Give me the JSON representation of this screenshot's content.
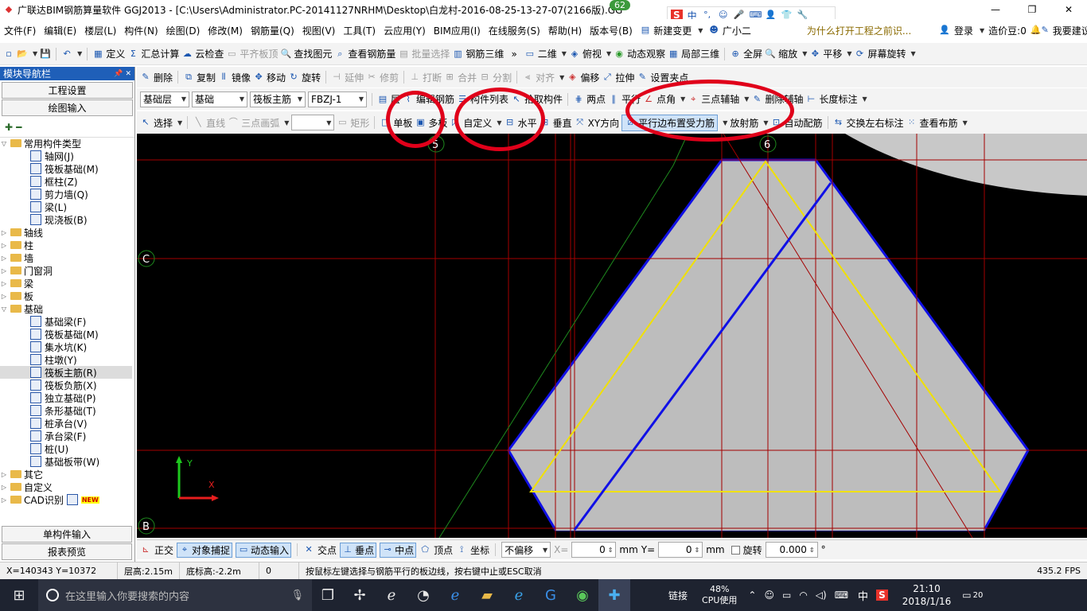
{
  "titlebar": {
    "title": "广联达BIM钢筋算量软件 GGJ2013 - [C:\\Users\\Administrator.PC-20141127NRHM\\Desktop\\白龙村-2016-08-25-13-27-07(2166版).GG",
    "badge": "62",
    "min": "—",
    "max": "❐",
    "close": "✕"
  },
  "ime": {
    "logo": "S",
    "lang": "中"
  },
  "menu": {
    "items": [
      "文件(F)",
      "编辑(E)",
      "楼层(L)",
      "构件(N)",
      "绘图(D)",
      "修改(M)",
      "钢筋量(Q)",
      "视图(V)",
      "工具(T)",
      "云应用(Y)",
      "BIM应用(I)",
      "在线服务(S)",
      "帮助(H)",
      "版本号(B)"
    ],
    "new_change": "新建变更",
    "guangxiao": "广小二",
    "notice": "为什么打开工程之前识...",
    "login": "登录",
    "price_bean": "造价豆:0",
    "suggest": "我要建议"
  },
  "tb1": {
    "items": [
      "定义",
      "汇总计算",
      "云检查",
      "平齐板顶",
      "查找图元",
      "查看钢筋量",
      "批量选择",
      "钢筋三维"
    ],
    "view2d": "二维",
    "top_view": "俯视",
    "dyn_observe": "动态观察",
    "local3d": "局部三维",
    "fullscreen": "全屏",
    "zoom": "缩放",
    "pan": "平移",
    "rotate_screen": "屏幕旋转"
  },
  "tb2": {
    "items": [
      "删除",
      "复制",
      "镜像",
      "移动",
      "旋转",
      "延伸",
      "修剪",
      "打断",
      "合并",
      "分割",
      "对齐",
      "偏移",
      "拉伸",
      "设置夹点"
    ]
  },
  "tb3": {
    "floor": "基础层",
    "category": "基础",
    "type": "筏板主筋",
    "name": "FBZJ-1",
    "layer": "层",
    "edit_rebar": "编辑钢筋",
    "comp_list": "构件列表",
    "pick": "拾取构件",
    "two_pts": "两点",
    "parallel": "平行",
    "pt_angle": "点角",
    "three_pt_aux": "三点辅轴",
    "del_aux": "删除辅轴",
    "dim": "长度标注"
  },
  "tb4": {
    "select": "选择",
    "line": "直线",
    "arc": "三点画弧",
    "rect": "矩形",
    "single": "单板",
    "multi": "多板",
    "custom": "自定义",
    "horizontal": "水平",
    "vertical": "垂直",
    "xy": "XY方向",
    "parallel_edge": "平行边布置受力筋",
    "rebar_dir": "放射筋",
    "auto_rebar": "自动配筋",
    "swap_lr": "交换左右标注",
    "view_rebar": "查看布筋"
  },
  "nav": {
    "title": "模块导航栏",
    "pin": "📌 ✕",
    "project_settings": "工程设置",
    "drawing_input": "绘图输入",
    "single_input": "单构件输入",
    "report": "报表预览"
  },
  "tree": {
    "common": "常用构件类型",
    "common_items": [
      "轴网(J)",
      "筏板基础(M)",
      "框柱(Z)",
      "剪力墙(Q)",
      "梁(L)",
      "现浇板(B)"
    ],
    "axis": "轴线",
    "column": "柱",
    "wall": "墙",
    "door": "门窗洞",
    "beam": "梁",
    "slab": "板",
    "foundation": "基础",
    "foundation_items": [
      "基础梁(F)",
      "筏板基础(M)",
      "集水坑(K)",
      "柱墩(Y)",
      "筏板主筋(R)",
      "筏板负筋(X)",
      "独立基础(P)",
      "条形基础(T)",
      "桩承台(V)",
      "承台梁(F)",
      "桩(U)",
      "基础板带(W)"
    ],
    "other": "其它",
    "custom": "自定义",
    "cad": "CAD识别",
    "new_badge": "NEW"
  },
  "canvas": {
    "axis_labels": [
      "5",
      "6",
      "C",
      "B"
    ],
    "y_axis": "Y",
    "x_axis": "X"
  },
  "bottombar": {
    "ortho": "正交",
    "snap": "对象捕捉",
    "dyn_input": "动态输入",
    "intersect": "交点",
    "perp": "垂点",
    "mid": "中点",
    "vertex": "顶点",
    "coord": "坐标",
    "offset": "不偏移",
    "x_label": "X=",
    "x_val": "0",
    "y_label": "Y=",
    "y_val": "0",
    "unit": "mm",
    "rotate": "旋转",
    "angle": "0.000",
    "deg": "°"
  },
  "status": {
    "coords": "X=140343 Y=10372",
    "floor_h": "层高:2.15m",
    "bottom_h": "底标高:-2.2m",
    "zero": "0",
    "hint": "按鼠标左键选择与钢筋平行的板边线，按右键中止或ESC取消",
    "fps": "435.2 FPS"
  },
  "taskbar": {
    "search": "在这里输入你要搜索的内容",
    "link": "链接",
    "cpu_pct": "48%",
    "cpu_label": "CPU使用",
    "lang": "中",
    "time": "21:10",
    "date": "2018/1/16",
    "notif": "20"
  }
}
